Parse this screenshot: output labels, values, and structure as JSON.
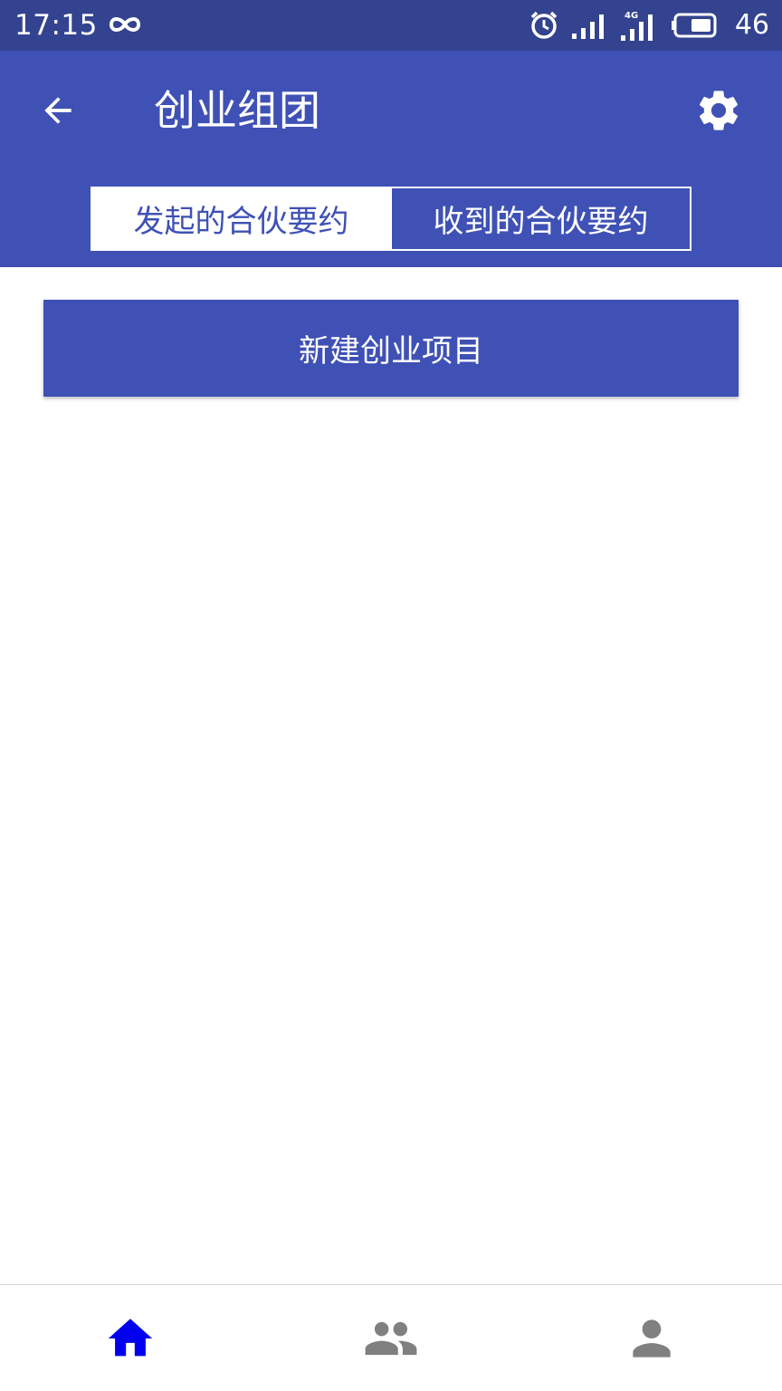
{
  "status_bar": {
    "time": "17:15",
    "battery_level": "46",
    "icons": [
      "infinity-icon",
      "alarm-icon",
      "signal-icon",
      "signal-4g-icon",
      "battery-icon"
    ]
  },
  "app_bar": {
    "title": "创业组团",
    "back_icon": "arrow-left-icon",
    "settings_icon": "gear-icon",
    "tabs": [
      {
        "label": "发起的合伙要约",
        "active": true
      },
      {
        "label": "收到的合伙要约",
        "active": false
      }
    ]
  },
  "main": {
    "new_project_label": "新建创业项目"
  },
  "bottom_nav": {
    "items": [
      {
        "icon": "home-icon",
        "active": true
      },
      {
        "icon": "people-icon",
        "active": false
      },
      {
        "icon": "person-icon",
        "active": false
      }
    ]
  },
  "colors": {
    "status_bar": "#33438f",
    "primary": "#3f51b5",
    "nav_active": "#0000ee",
    "nav_inactive": "#808080"
  }
}
